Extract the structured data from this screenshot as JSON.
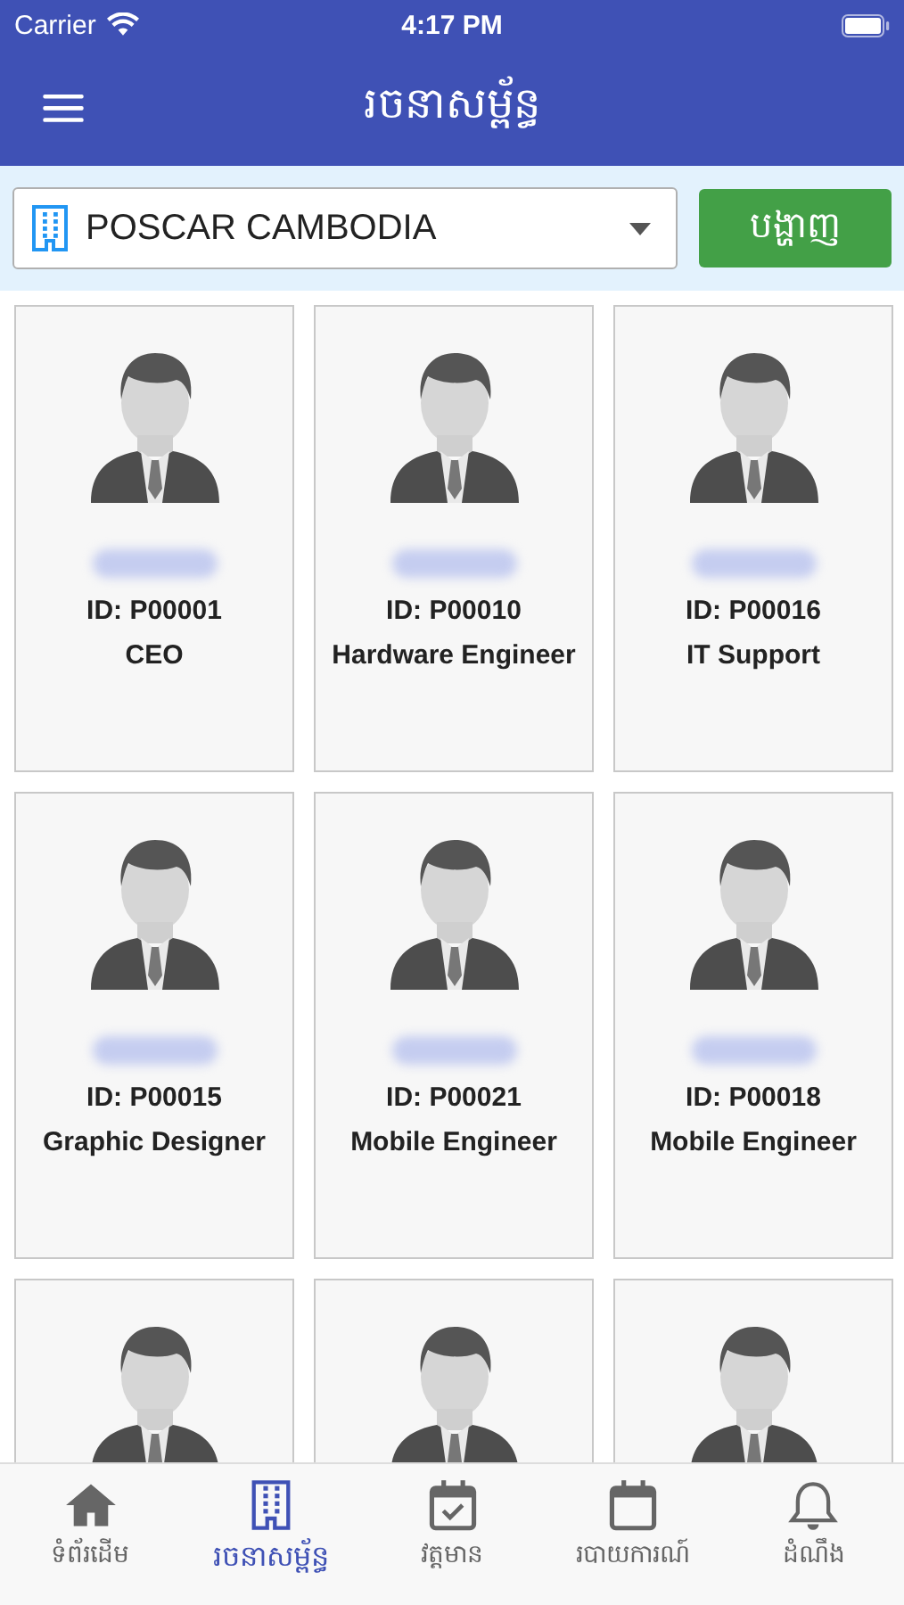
{
  "status_bar": {
    "carrier": "Carrier",
    "time": "4:17 PM"
  },
  "header": {
    "title": "រចនាសម្ព័ន្ធ"
  },
  "filter": {
    "company": "POSCAR CAMBODIA",
    "button": "បង្ហាញ"
  },
  "employees": [
    {
      "kind": "full",
      "id": "ID: P00001",
      "role": "CEO"
    },
    {
      "kind": "full",
      "id": "ID: P00010",
      "role": "Hardware Engineer"
    },
    {
      "kind": "full",
      "id": "ID: P00016",
      "role": "IT Support"
    },
    {
      "kind": "full",
      "id": "ID: P00015",
      "role": "Graphic Designer"
    },
    {
      "kind": "full",
      "id": "ID: P00021",
      "role": "Mobile Engineer"
    },
    {
      "kind": "full",
      "id": "ID: P00018",
      "role": "Mobile Engineer"
    },
    {
      "kind": "partial"
    },
    {
      "kind": "partial"
    },
    {
      "kind": "partial"
    }
  ],
  "tab_bar": [
    {
      "label": "ទំព័រដើម",
      "kind": "home",
      "selected": false
    },
    {
      "label": "រចនាសម្ព័ន្ធ",
      "kind": "structure",
      "selected": true
    },
    {
      "label": "វត្តមាន",
      "kind": "attendance",
      "selected": false
    },
    {
      "label": "របាយការណ៍",
      "kind": "report",
      "selected": false
    },
    {
      "label": "ដំណឹង",
      "kind": "news",
      "selected": false
    }
  ]
}
